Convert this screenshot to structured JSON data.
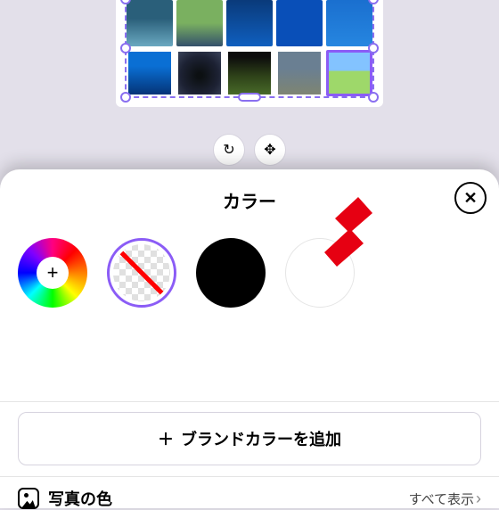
{
  "toolbar": {
    "rotate_icon": "rotate-icon",
    "move_icon": "move-icon"
  },
  "sheet": {
    "title": "カラー",
    "close_aria": "閉じる",
    "swatches": {
      "picker_plus": "+",
      "none_selected": true,
      "colors": [
        "#000000",
        "#FFFFFF"
      ]
    },
    "brand_button_label": "ブランドカラーを追加",
    "brand_button_plus": "＋",
    "photo_section_label": "写真の色",
    "see_all_label": "すべて表示"
  },
  "arrow_color": "#E60012"
}
